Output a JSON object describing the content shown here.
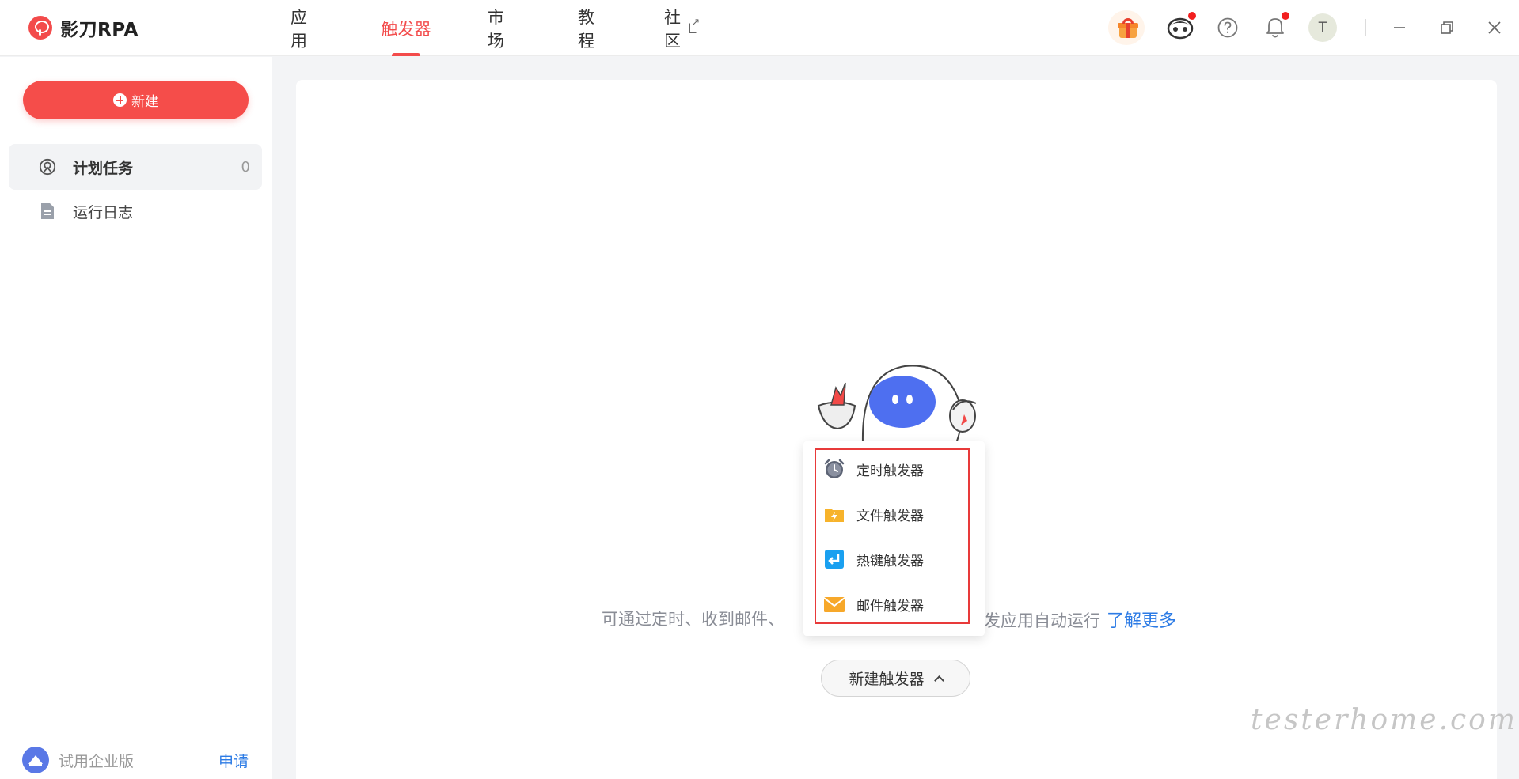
{
  "app": {
    "name": "影刀RPA"
  },
  "nav": [
    {
      "label": "应用",
      "active": false
    },
    {
      "label": "触发器",
      "active": true
    },
    {
      "label": "市场",
      "active": false
    },
    {
      "label": "教程",
      "active": false
    },
    {
      "label": "社区",
      "active": false,
      "external": true
    }
  ],
  "topbar": {
    "avatar_initial": "T",
    "accent_color": "#f34b4b"
  },
  "sidebar": {
    "new_button_label": "新建",
    "items": [
      {
        "label": "计划任务",
        "count": "0",
        "active": true,
        "icon": "radar-icon"
      },
      {
        "label": "运行日志",
        "active": false,
        "icon": "document-icon"
      }
    ],
    "footer": {
      "label": "试用企业版",
      "link": "申请"
    }
  },
  "main": {
    "description_prefix": "可通过定时、收到邮件、",
    "description_suffix": "发应用自动运行",
    "learn_more": "了解更多",
    "new_trigger_button": "新建触发器",
    "dropdown": [
      {
        "label": "定时触发器",
        "icon": "clock-icon"
      },
      {
        "label": "文件触发器",
        "icon": "folder-bolt-icon"
      },
      {
        "label": "热键触发器",
        "icon": "hotkey-icon"
      },
      {
        "label": "邮件触发器",
        "icon": "mail-icon"
      }
    ]
  },
  "watermark": "testerhome.com"
}
